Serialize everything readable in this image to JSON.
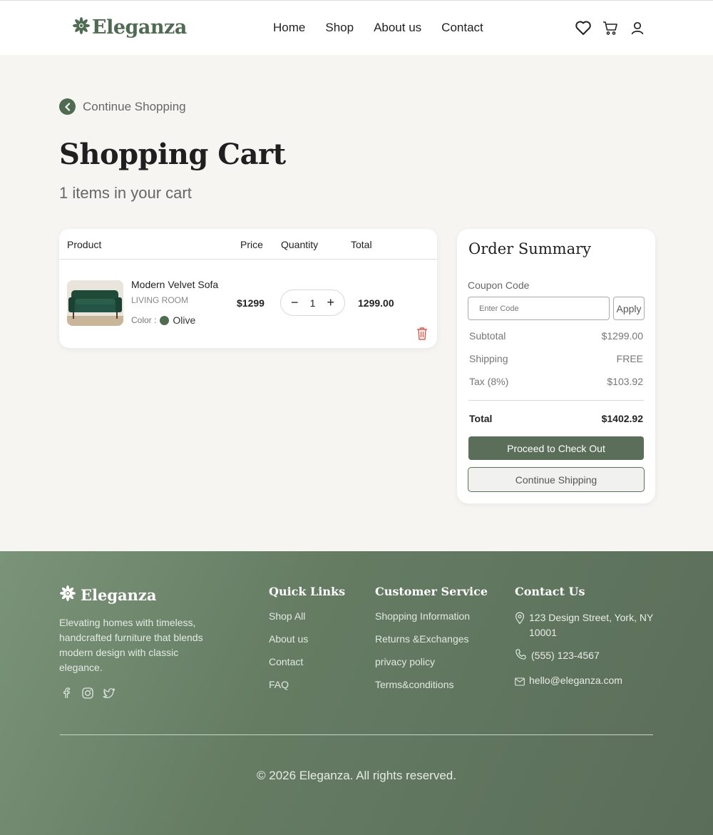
{
  "header": {
    "brand": "Eleganza",
    "nav": [
      "Home",
      "Shop",
      "About us",
      "Contact"
    ],
    "icons": [
      "heart-icon",
      "cart-icon",
      "user-icon"
    ]
  },
  "back_link": "Continue Shopping",
  "page": {
    "title": "Shopping Cart",
    "count": "1 items in your cart"
  },
  "cart": {
    "columns": [
      "Product",
      "Price",
      "Quantity",
      "Total"
    ],
    "items": [
      {
        "name": "Modern Velvet Sofa",
        "category": "LIVING ROOM",
        "color_label": "Color :",
        "color_value": "Olive",
        "color_hex": "#4f6b52",
        "price": "$1299",
        "quantity": "1",
        "total": "1299.00"
      }
    ]
  },
  "summary": {
    "title": "Order Summary",
    "coupon_label": "Coupon Code",
    "coupon_placeholder": "Enter Code",
    "apply_label": "Apply",
    "subtotal_label": "Subtotal",
    "subtotal_value": "$1299.00",
    "shipping_label": "Shipping",
    "shipping_value": "FREE",
    "tax_label": "Tax (8%)",
    "tax_value": "$103.92",
    "total_label": "Total",
    "total_value": "$1402.92",
    "checkout_label": "Proceed to Check Out",
    "continue_label": "Continue Shipping"
  },
  "footer": {
    "brand": "Eleganza",
    "description": "Elevating homes with timeless, handcrafted furniture that blends modern design with classic elegance.",
    "social": [
      "facebook-icon",
      "instagram-icon",
      "twitter-icon"
    ],
    "quick_links": {
      "title": "Quick Links",
      "links": [
        "Shop All",
        "About us",
        "Contact",
        "FAQ"
      ]
    },
    "customer_service": {
      "title": "Customer Service",
      "links": [
        "Shopping Information",
        "Returns &Exchanges",
        "privacy policy",
        "Terms&conditions"
      ]
    },
    "contact": {
      "title": "Contact Us",
      "address": "123 Design Street, York, NY 10001",
      "phone": "(555) 123-4567",
      "email": "hello@eleganza.com"
    },
    "copyright": "© 2026 Eleganza. All rights reserved."
  },
  "colors": {
    "accent": "#4f6b52",
    "button": "#5a6e59",
    "footer_bg": "#657c63",
    "page_bg": "#f6f5f2",
    "delete": "#e05a4f"
  }
}
